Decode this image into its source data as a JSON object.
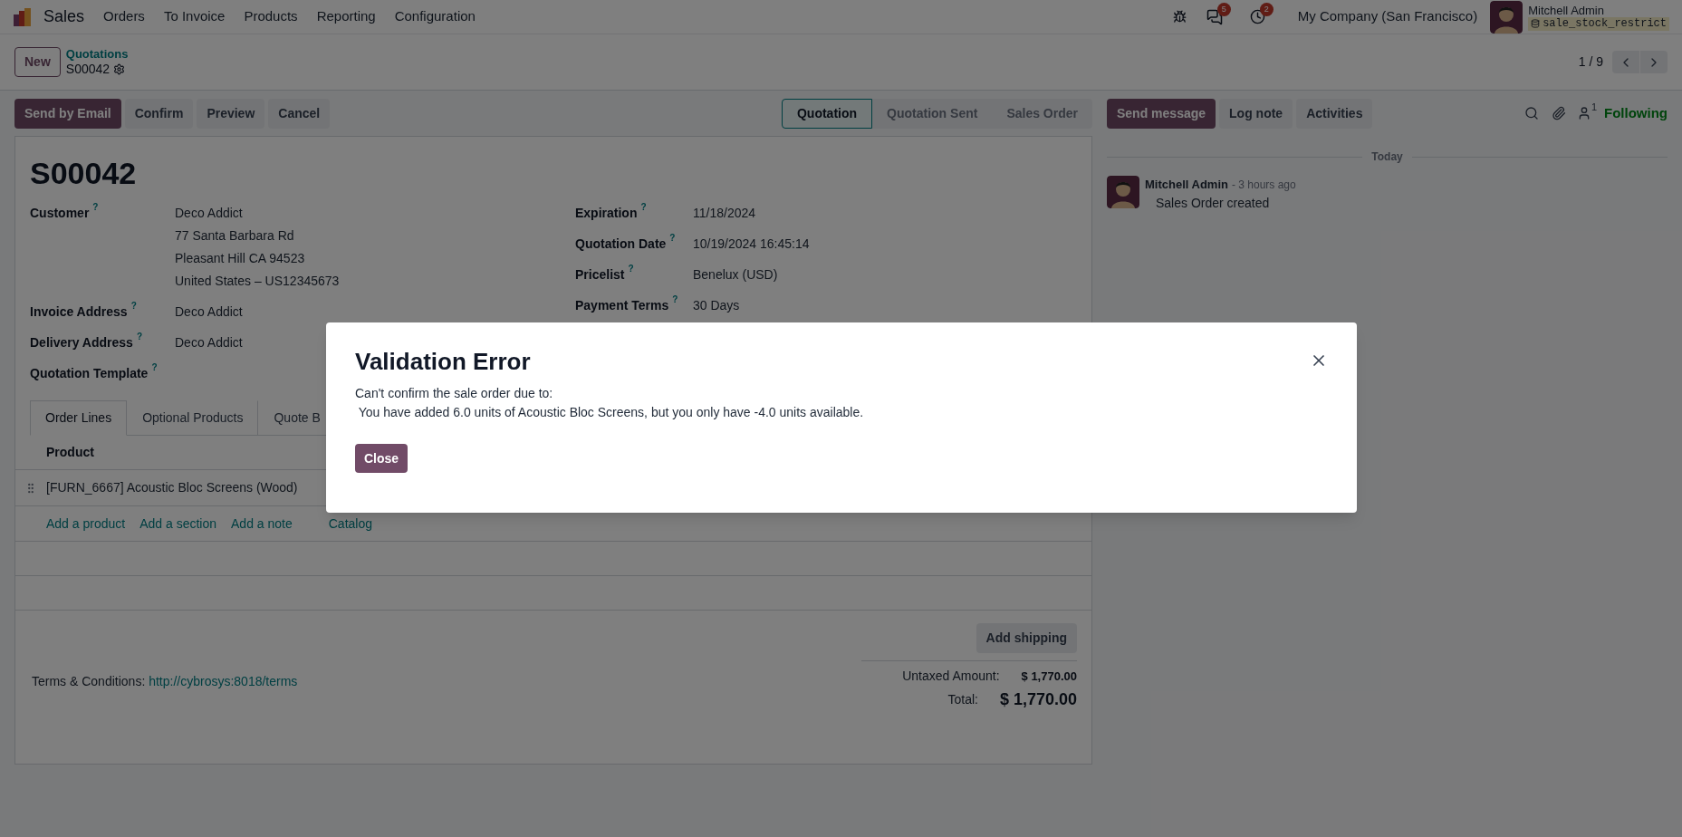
{
  "top_nav": {
    "app": "Sales",
    "menu": [
      "Orders",
      "To Invoice",
      "Products",
      "Reporting",
      "Configuration"
    ],
    "messages_badge": "5",
    "activities_badge": "2",
    "company": "My Company (San Francisco)",
    "user": "Mitchell Admin",
    "database": "sale_stock_restrict"
  },
  "control_panel": {
    "new_button": "New",
    "breadcrumb": "Quotations",
    "record": "S00042",
    "pager": "1 / 9"
  },
  "actions": [
    {
      "label": "Send by Email",
      "kind": "primary"
    },
    {
      "label": "Confirm",
      "kind": "secondary"
    },
    {
      "label": "Preview",
      "kind": "secondary"
    },
    {
      "label": "Cancel",
      "kind": "secondary"
    }
  ],
  "status_steps": [
    {
      "label": "Quotation",
      "selected": true
    },
    {
      "label": "Quotation Sent",
      "selected": false
    },
    {
      "label": "Sales Order",
      "selected": false
    }
  ],
  "form": {
    "title": "S00042",
    "left_fields": [
      {
        "label": "Customer",
        "help": "?",
        "values": [
          "Deco Addict",
          "77 Santa Barbara Rd",
          "Pleasant Hill CA 94523",
          "United States – US12345673"
        ]
      },
      {
        "label": "Invoice Address",
        "help": "?",
        "values": [
          "Deco Addict"
        ]
      },
      {
        "label": "Delivery Address",
        "help": "?",
        "values": [
          "Deco Addict"
        ]
      },
      {
        "label": "Quotation Template",
        "help": "?"
      }
    ],
    "right_fields": [
      {
        "label": "Expiration",
        "help": "?",
        "values": [
          "11/18/2024"
        ]
      },
      {
        "label": "Quotation Date",
        "help": "?",
        "values": [
          "10/19/2024 16:45:14"
        ]
      },
      {
        "label": "Pricelist",
        "help": "?",
        "values": [
          "Benelux (USD)"
        ]
      },
      {
        "label": "Payment Terms",
        "help": "?",
        "values": [
          "30 Days"
        ]
      }
    ],
    "tabs": [
      {
        "label": "Order Lines",
        "selected": true
      },
      {
        "label": "Optional Products",
        "selected": false
      },
      {
        "label": "Quote B",
        "selected": false
      }
    ],
    "table": {
      "columns": [
        "Product"
      ],
      "rows": [
        {
          "product": "[FURN_6667] Acoustic Bloc Screens (Wood)"
        }
      ]
    },
    "add_links": [
      "Add a product",
      "Add a section",
      "Add a note"
    ],
    "catalog_link": "Catalog",
    "add_shipping": "Add shipping",
    "terms_label": "Terms & Conditions:",
    "terms_link": "http://cybrosys:8018/terms",
    "totals": [
      {
        "label": "Untaxed Amount:",
        "value": "$ 1,770.00",
        "kind": "subtotal"
      },
      {
        "label": "Total:",
        "value": "$ 1,770.00",
        "kind": "grand"
      }
    ]
  },
  "chatter": {
    "buttons": [
      {
        "label": "Send message",
        "kind": "primary"
      },
      {
        "label": "Log note",
        "kind": "secondary"
      },
      {
        "label": "Activities",
        "kind": "secondary"
      }
    ],
    "followers_count": "1",
    "follow_status": "Following",
    "date_divider": "Today",
    "messages": [
      {
        "author": "Mitchell Admin",
        "time": "- 3 hours ago",
        "body": "Sales Order created"
      }
    ]
  },
  "dialog": {
    "title": "Validation Error",
    "lines": [
      "Can't confirm the sale order due to:",
      " You have added 6.0 units of Acoustic Bloc Screens, but you only have -4.0 units available."
    ],
    "close_button": "Close"
  }
}
